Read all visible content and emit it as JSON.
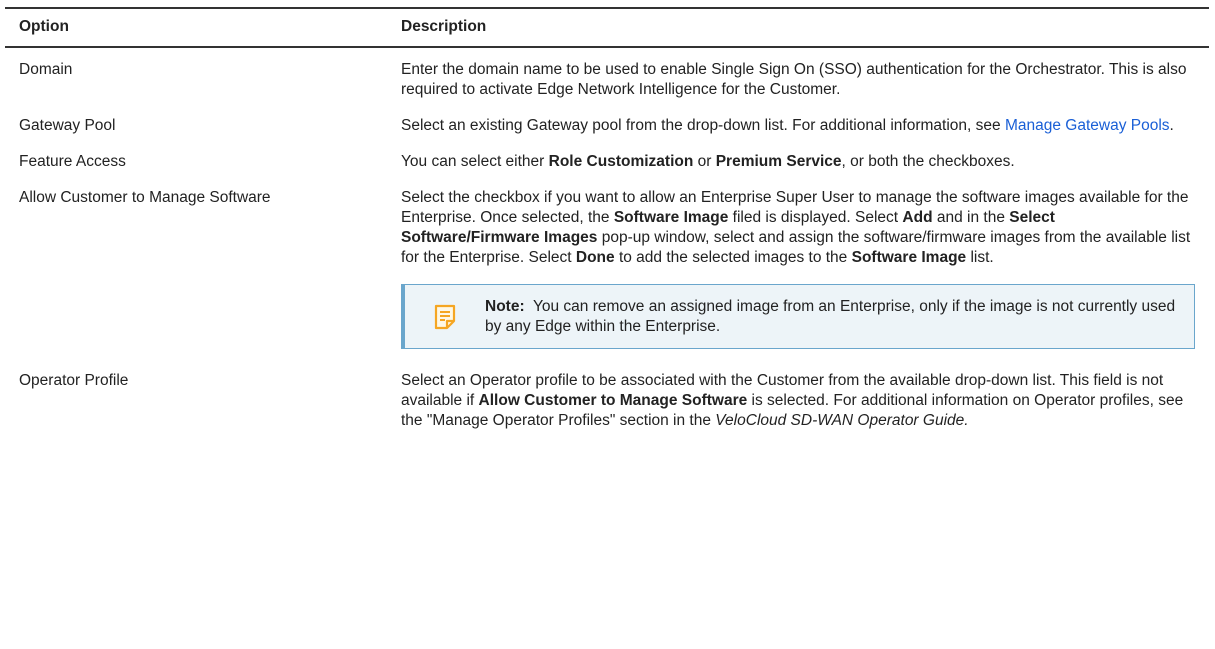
{
  "table": {
    "headers": {
      "option": "Option",
      "description": "Description"
    },
    "rows": [
      {
        "option": "Domain",
        "description": "Enter the domain name to be used to enable Single Sign On (SSO) authentication for the Orchestrator. This is also required to activate Edge Network Intelligence for the Customer."
      },
      {
        "option": "Gateway Pool",
        "desc_text": "Select an existing Gateway pool from the drop-down list. For additional information, see ",
        "desc_link": "Manage Gateway Pools",
        "desc_end": "."
      },
      {
        "option": "Feature Access",
        "d1": "You can select either ",
        "b1": "Role Customization",
        "d2": " or ",
        "b2": "Premium Service",
        "d3": ", or both the checkboxes."
      },
      {
        "option": "Allow Customer to Manage Software",
        "d1": "Select the checkbox if you want to allow an Enterprise Super User to manage the software images available for the Enterprise. Once selected, the ",
        "b1": "Software Image",
        "d2": " filed is displayed. Select ",
        "b2": "Add",
        "d3": " and in the ",
        "b3": "Select Software/Firmware Images",
        "d4": " pop-up window, select and assign the software/firmware images from the available list for the Enterprise. Select ",
        "b4": "Done",
        "d5": " to add the selected images to the ",
        "b5": "Software Image",
        "d6": " list.",
        "note": {
          "label": "Note:",
          "text": "  You can remove an assigned image from an Enterprise, only if the image is not currently used by any Edge within the Enterprise.",
          "icon": "note-icon",
          "accent": "#f5a623"
        }
      },
      {
        "option": "Operator Profile",
        "d1": "Select an Operator profile to be associated with the Customer from the available drop-down list. This field is not available if ",
        "b1": "Allow Customer to Manage Software",
        "d2": " is selected. For additional information on Operator profiles, see the \"Manage Operator Profiles\" section in the ",
        "i1": "VeloCloud SD-WAN Operator Guide.",
        "d3": ""
      }
    ]
  }
}
